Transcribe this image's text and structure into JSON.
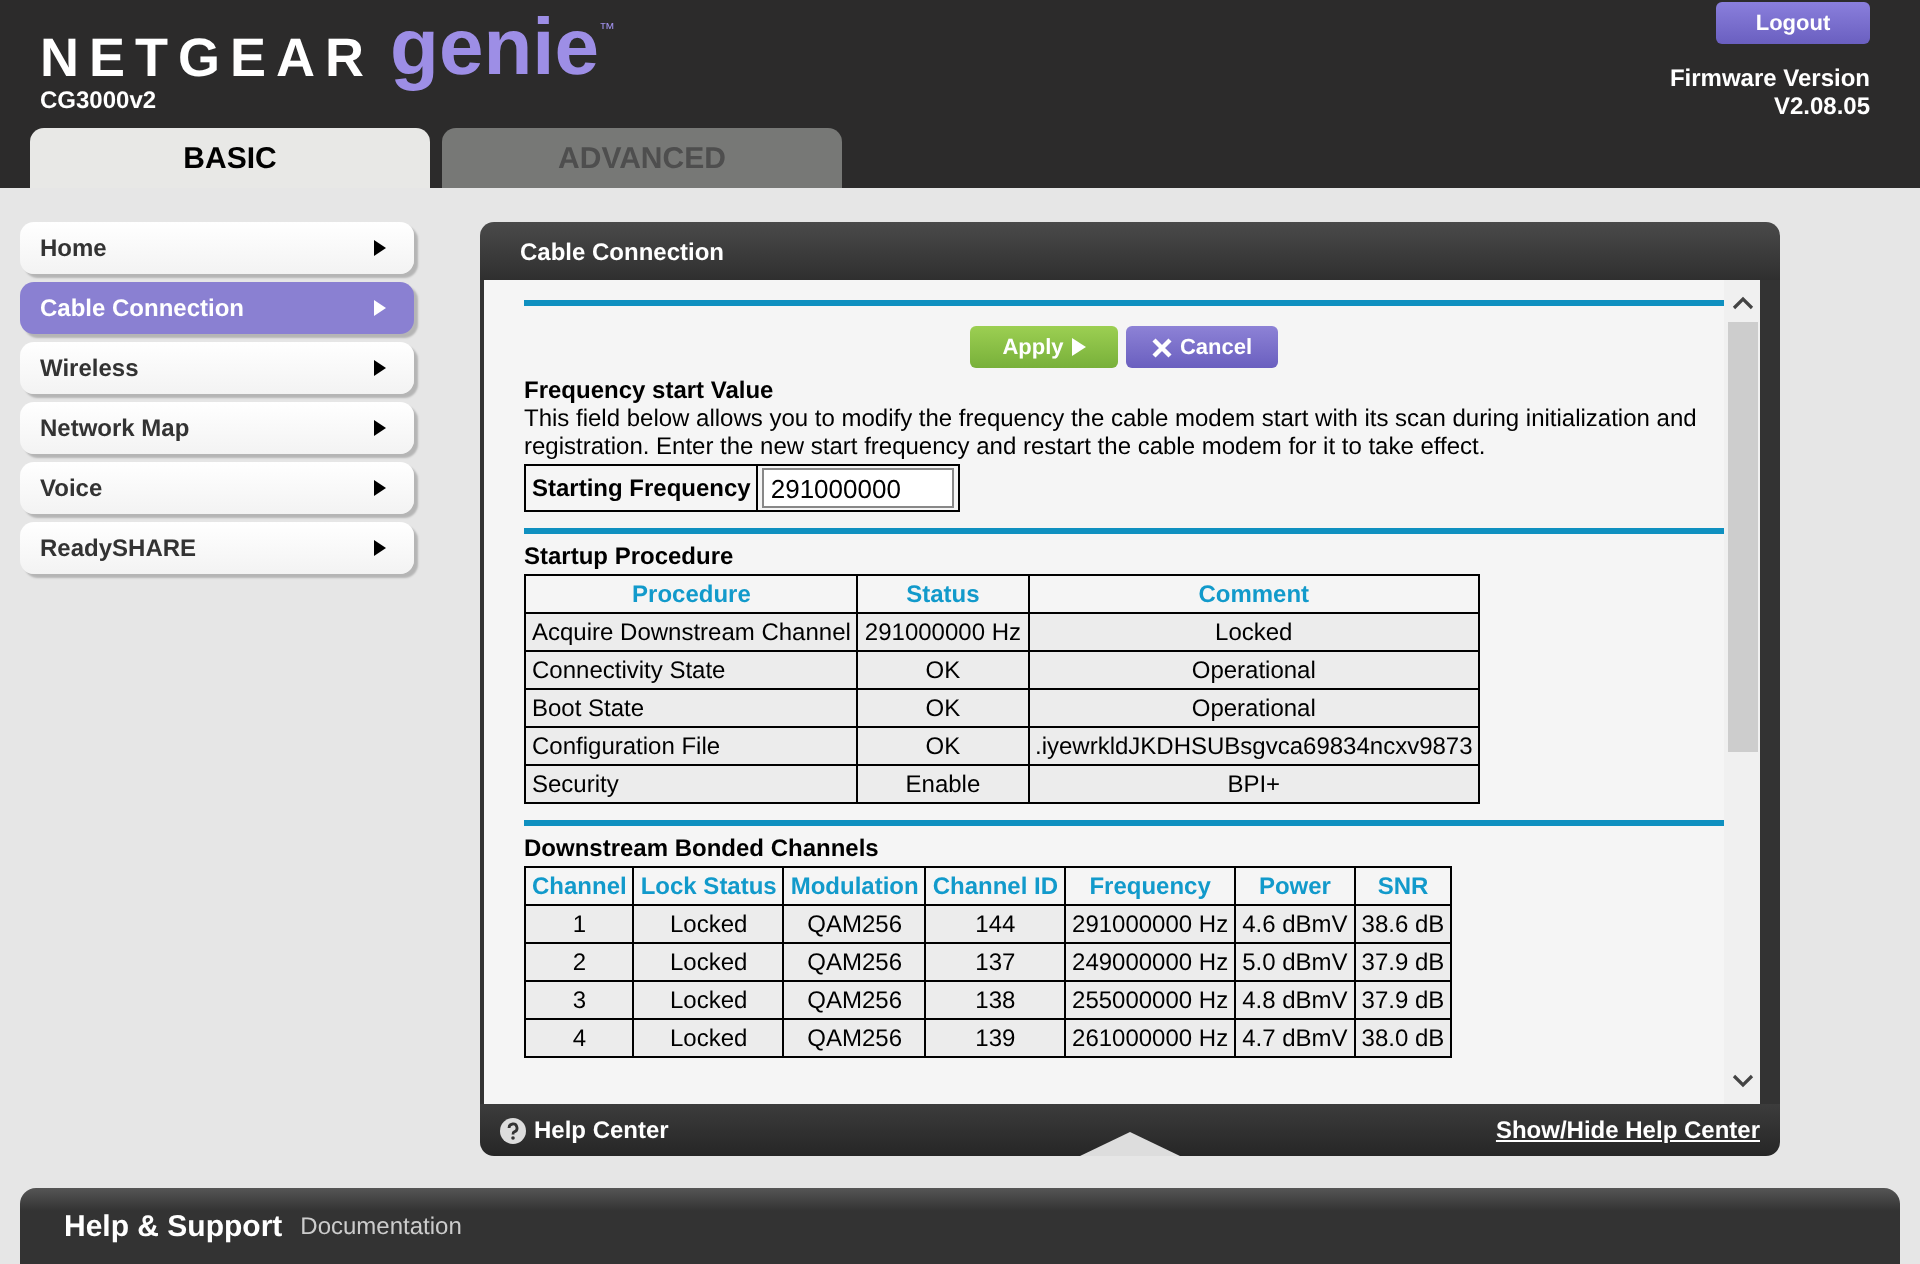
{
  "header": {
    "brand": "NETGEAR",
    "product": "genie",
    "trademark": "™",
    "model": "CG3000v2",
    "logout": "Logout",
    "firmware_label": "Firmware Version",
    "firmware_version": "V2.08.05"
  },
  "tabs": [
    {
      "label": "BASIC",
      "selected": true
    },
    {
      "label": "ADVANCED",
      "selected": false
    }
  ],
  "sidebar": {
    "items": [
      {
        "label": "Home",
        "selected": false
      },
      {
        "label": "Cable Connection",
        "selected": true
      },
      {
        "label": "Wireless",
        "selected": false
      },
      {
        "label": "Network Map",
        "selected": false
      },
      {
        "label": "Voice",
        "selected": false
      },
      {
        "label": "ReadySHARE",
        "selected": false
      }
    ]
  },
  "panel": {
    "title": "Cable Connection",
    "apply": "Apply",
    "cancel": "Cancel",
    "frequency": {
      "title": "Frequency start Value",
      "description": "This field below allows you to modify the frequency the cable modem start with its scan during initialization and registration. Enter the new start frequency and restart the cable modem for it to take effect.",
      "field_label": "Starting Frequency",
      "value": "291000000"
    },
    "startup": {
      "title": "Startup Procedure",
      "columns": [
        "Procedure",
        "Status",
        "Comment"
      ],
      "rows": [
        [
          "Acquire Downstream Channel",
          "291000000 Hz",
          "Locked"
        ],
        [
          "Connectivity State",
          "OK",
          "Operational"
        ],
        [
          "Boot State",
          "OK",
          "Operational"
        ],
        [
          "Configuration File",
          "OK",
          ".iyewrkldJKDHSUBsgvca69834ncxv9873"
        ],
        [
          "Security",
          "Enable",
          "BPI+"
        ]
      ]
    },
    "downstream": {
      "title": "Downstream Bonded Channels",
      "columns": [
        "Channel",
        "Lock Status",
        "Modulation",
        "Channel ID",
        "Frequency",
        "Power",
        "SNR"
      ],
      "rows": [
        [
          "1",
          "Locked",
          "QAM256",
          "144",
          "291000000 Hz",
          "4.6 dBmV",
          "38.6 dB"
        ],
        [
          "2",
          "Locked",
          "QAM256",
          "137",
          "249000000 Hz",
          "5.0 dBmV",
          "37.9 dB"
        ],
        [
          "3",
          "Locked",
          "QAM256",
          "138",
          "255000000 Hz",
          "4.8 dBmV",
          "37.9 dB"
        ],
        [
          "4",
          "Locked",
          "QAM256",
          "139",
          "261000000 Hz",
          "4.7 dBmV",
          "38.0 dB"
        ]
      ]
    },
    "help_center": "Help Center",
    "help_toggle": "Show/Hide Help Center"
  },
  "footer": {
    "title": "Help & Support",
    "link": "Documentation"
  }
}
